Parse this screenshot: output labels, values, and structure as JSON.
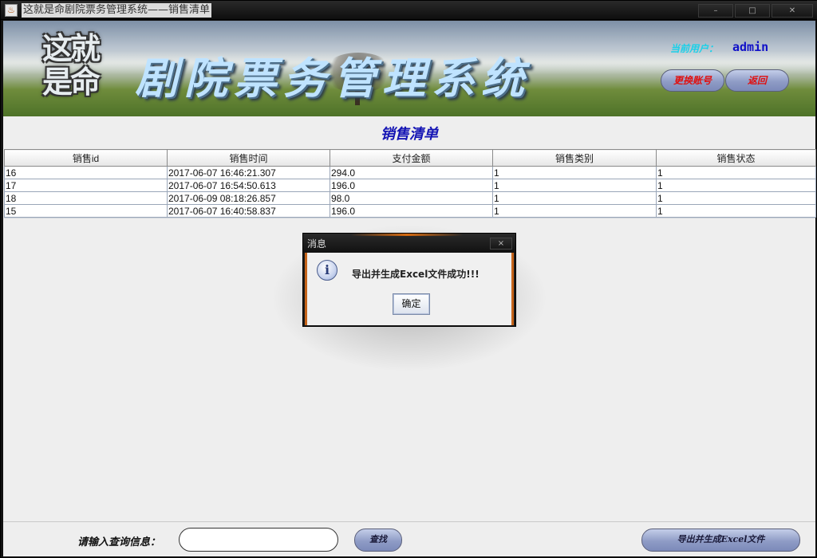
{
  "window": {
    "title": "这就是命剧院票务管理系统——销售清单",
    "icon": "java-cup-icon",
    "minimize": "–",
    "maximize": "□",
    "close": "✕"
  },
  "banner": {
    "logo_text_line1": "这就",
    "logo_text_line2": "是命",
    "title": "剧院票务管理系统",
    "current_user_label": "当前用户：",
    "current_user": "admin",
    "switch_account": "更换账号",
    "back": "返回"
  },
  "page": {
    "heading": "销售清单"
  },
  "table": {
    "headers": [
      "销售id",
      "销售时间",
      "支付金额",
      "销售类别",
      "销售状态"
    ],
    "rows": [
      [
        "16",
        "2017-06-07 16:46:21.307",
        "294.0",
        "1",
        "1"
      ],
      [
        "17",
        "2017-06-07 16:54:50.613",
        "196.0",
        "1",
        "1"
      ],
      [
        "18",
        "2017-06-09 08:18:26.857",
        "98.0",
        "1",
        "1"
      ],
      [
        "15",
        "2017-06-07 16:40:58.837",
        "196.0",
        "1",
        "1"
      ]
    ]
  },
  "dialog": {
    "title": "消息",
    "icon": "info-icon",
    "message": "导出并生成Excel文件成功!!!",
    "ok": "确定",
    "close": "×"
  },
  "footer": {
    "search_label": "请输入查询信息：",
    "search_value": "",
    "search_button": "查找",
    "export_button": "导出并生成Excel文件"
  },
  "colors": {
    "heading": "#1414b4",
    "user_label": "#1bd0e8",
    "user_name": "#1010c8",
    "action_text": "#e01010",
    "button_gradient_top": "#c4cee9",
    "button_gradient_bottom": "#7c8ab9"
  }
}
